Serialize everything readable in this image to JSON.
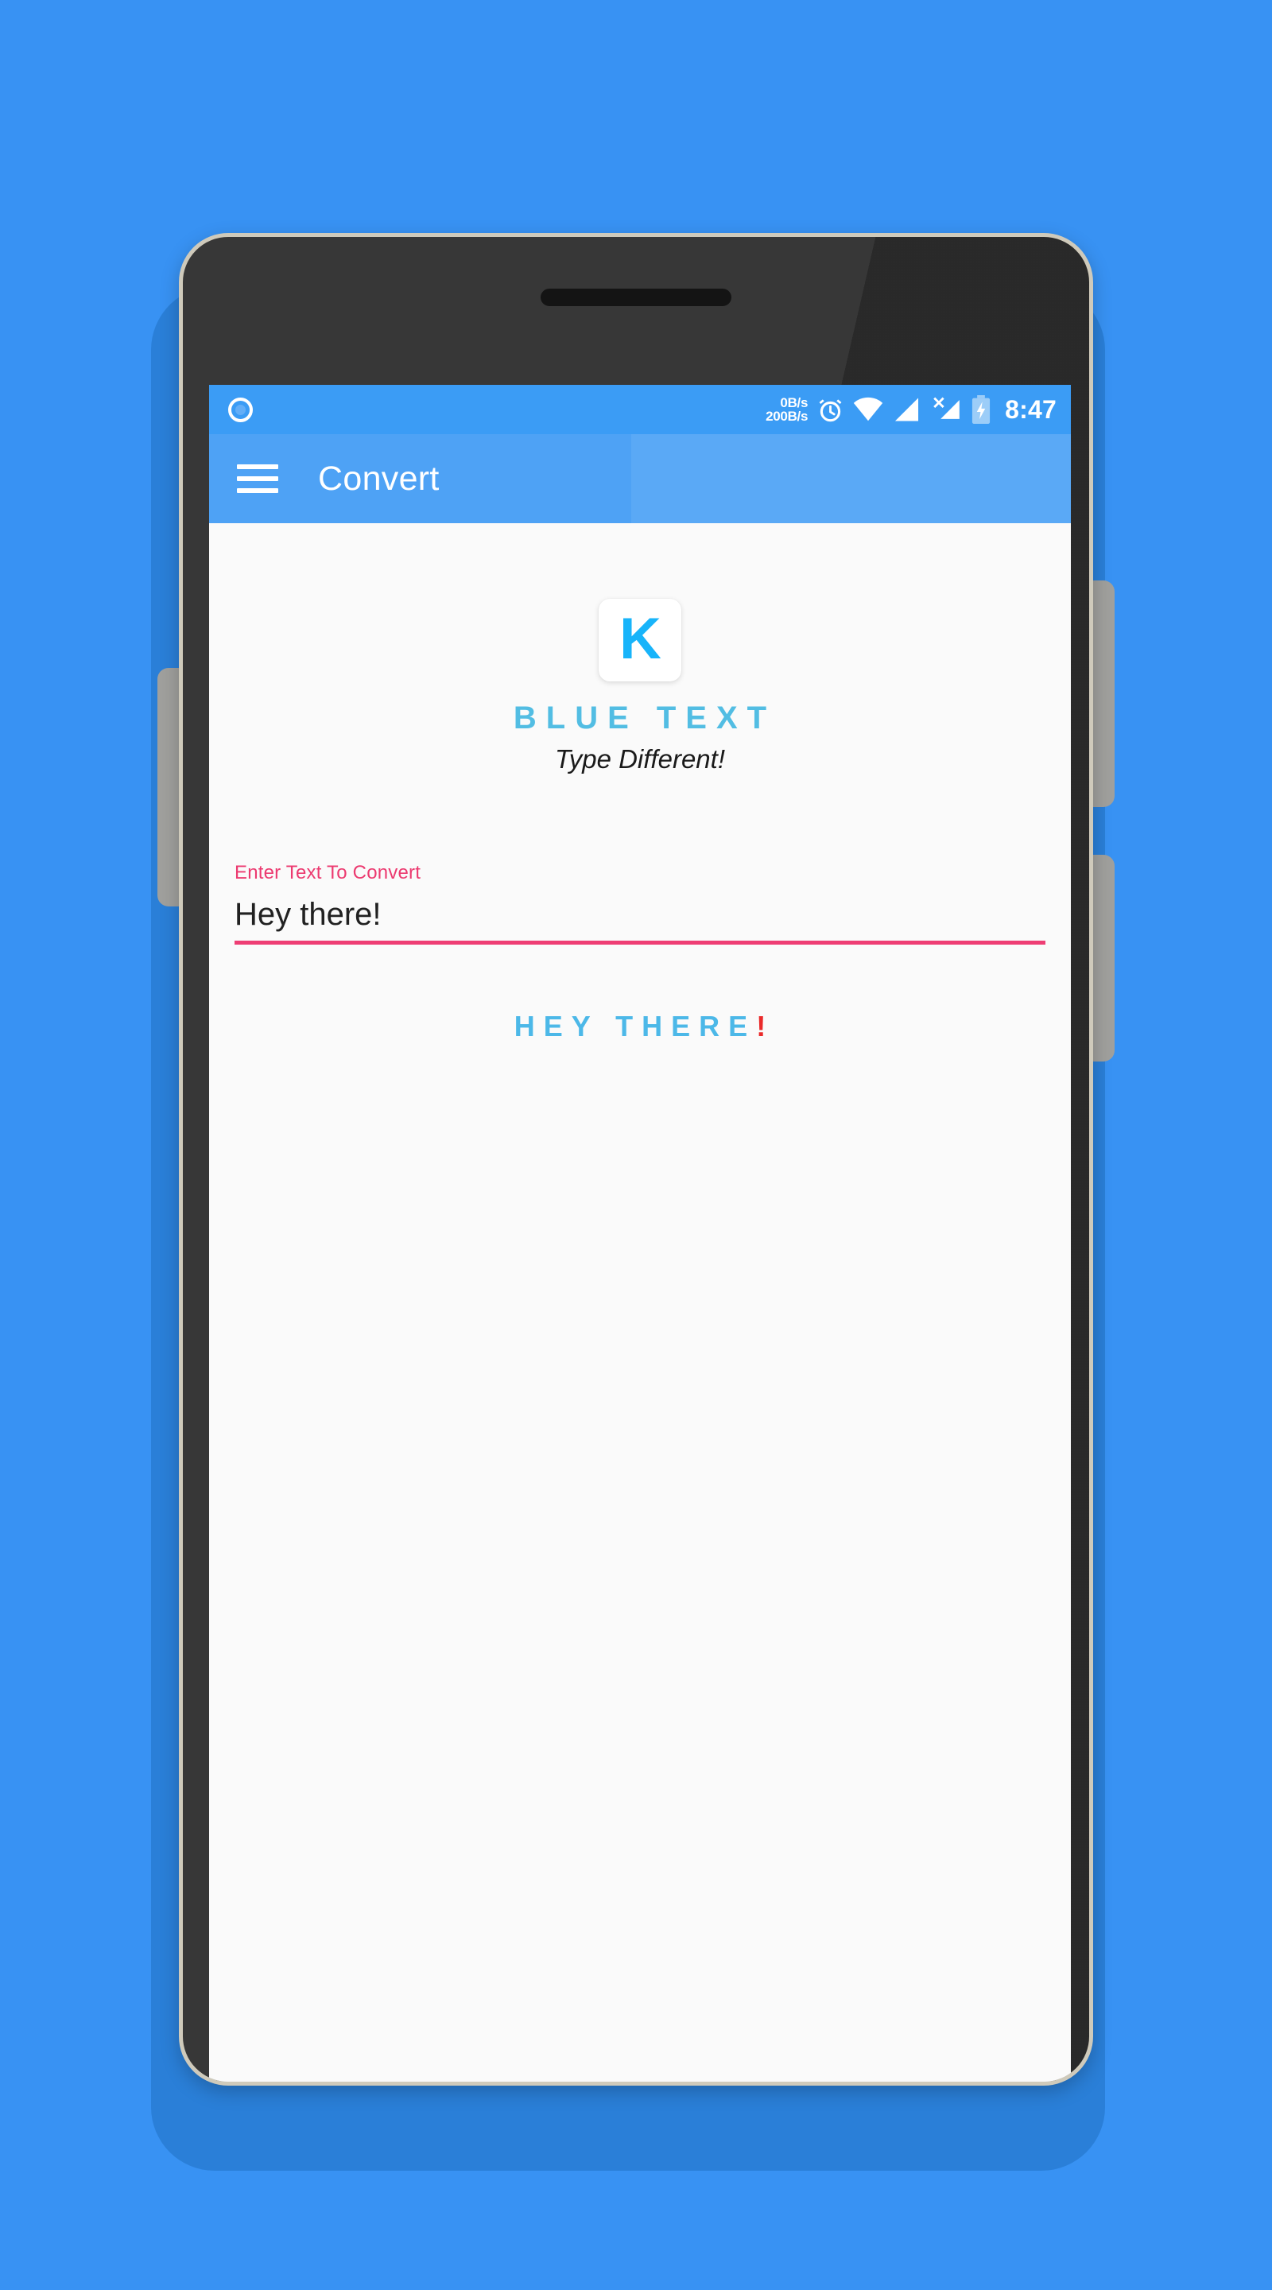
{
  "device": {
    "frame_color": "#2e2e2e",
    "bezel_color": "#cfcabb",
    "background_color": "#3892f3",
    "hardware": {
      "earpiece": "earpiece-speaker",
      "camera": "front-camera",
      "home_button": "home-button",
      "left_button": "volume-rocker",
      "right_button_top": "power-button",
      "right_button_bottom": "volume-button"
    }
  },
  "status_bar": {
    "background_color": "#3b9cf5",
    "left_icon": "screen-record-indicator-icon",
    "network_speed_up": "0B/s",
    "network_speed_down": "200B/s",
    "icons": [
      "alarm-icon",
      "wifi-icon",
      "signal-icon",
      "signal-no-service-icon",
      "battery-charging-icon"
    ],
    "time": "8:47"
  },
  "app_bar": {
    "menu_icon": "hamburger-menu-icon",
    "title": "Convert",
    "background_color": "#4ea2f5",
    "text_color": "#ffffff"
  },
  "main": {
    "logo": {
      "letter": "K",
      "color": "#18b4fa",
      "card_background": "#ffffff"
    },
    "brand_title": "BLUE TEXT",
    "brand_title_color": "#52bde3",
    "tagline": "Type Different!",
    "input": {
      "label": "Enter Text To Convert",
      "label_color": "#ec3a70",
      "value": "Hey there!",
      "underline_color": "#ee3e74"
    },
    "output": {
      "text": "HEY THERE",
      "text_color": "#4cb8e8",
      "suffix": "!",
      "suffix_color": "#ea2a2a"
    }
  }
}
